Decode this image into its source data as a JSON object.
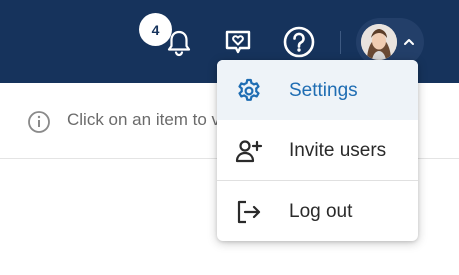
{
  "header": {
    "notification_count": "4",
    "icons": [
      "bell-icon",
      "feedback-heart-icon",
      "help-icon",
      "chevron-down-icon"
    ]
  },
  "info": {
    "message": "Click on an item to view"
  },
  "user_menu": {
    "items": [
      {
        "label": "Settings",
        "icon": "gear-icon",
        "active": true
      },
      {
        "label": "Invite users",
        "icon": "add-user-icon",
        "active": false
      },
      {
        "label": "Log out",
        "icon": "logout-icon",
        "active": false
      }
    ]
  },
  "colors": {
    "header_bg": "#16335c",
    "accent": "#1f6db3",
    "active_item_bg": "#eef3f8"
  }
}
